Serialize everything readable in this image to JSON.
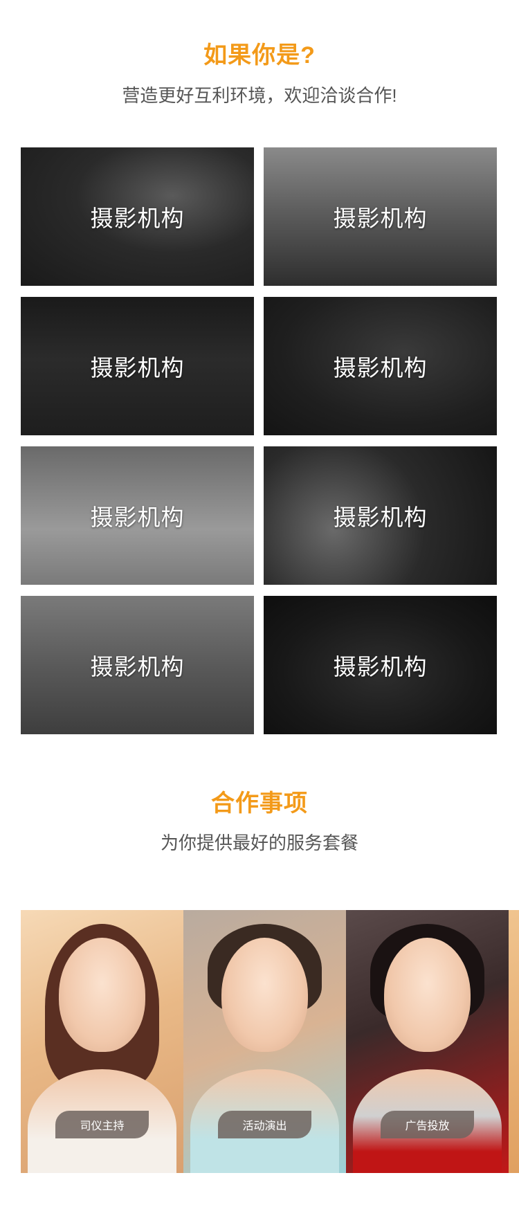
{
  "intro": {
    "title": "如果你是?",
    "subtitle": "营造更好互利环境，欢迎洽谈合作!"
  },
  "tiles": [
    {
      "label": "摄影机构"
    },
    {
      "label": "摄影机构"
    },
    {
      "label": "摄影机构"
    },
    {
      "label": "摄影机构"
    },
    {
      "label": "摄影机构"
    },
    {
      "label": "摄影机构"
    },
    {
      "label": "摄影机构"
    },
    {
      "label": "摄影机构"
    }
  ],
  "cooperation": {
    "title": "合作事项",
    "subtitle": "为你提供最好的服务套餐"
  },
  "services": [
    {
      "label": "司仪主持"
    },
    {
      "label": "活动演出"
    },
    {
      "label": "广告投放"
    }
  ],
  "colors": {
    "accent": "#f39a19",
    "subtitle": "#555555"
  }
}
